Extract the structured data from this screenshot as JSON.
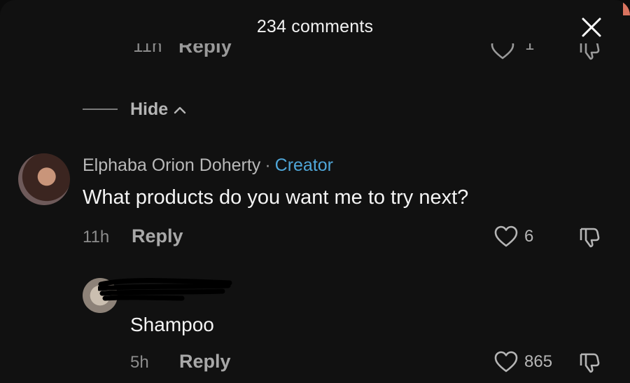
{
  "header": {
    "title": "234 comments"
  },
  "previous_row": {
    "time": "11h",
    "reply_label": "Reply",
    "like_count": "1"
  },
  "hide": {
    "label": "Hide"
  },
  "comment": {
    "author": "Elphaba Orion Doherty",
    "separator": "·",
    "badge": "Creator",
    "text": "What products do you want me to try next?",
    "time": "11h",
    "reply_label": "Reply",
    "like_count": "6"
  },
  "reply": {
    "text": "Shampoo",
    "time": "5h",
    "reply_label": "Reply",
    "like_count": "865"
  },
  "colors": {
    "background": "#111111",
    "creator_badge": "#4fa6d8",
    "muted_text": "#a8a8a8"
  }
}
